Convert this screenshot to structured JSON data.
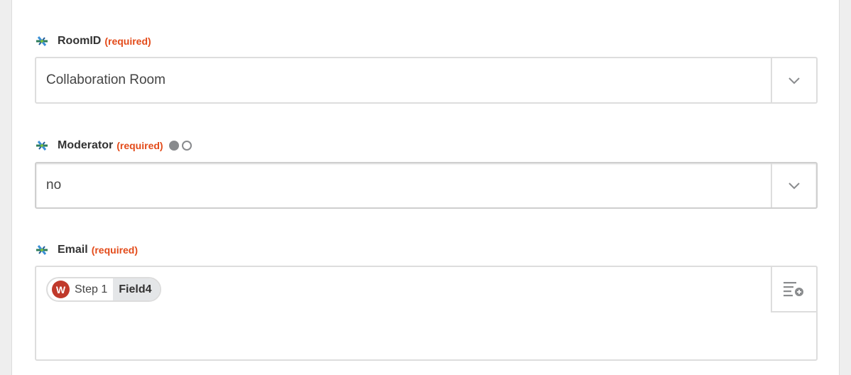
{
  "fields": [
    {
      "label": "RoomID",
      "required_text": "(required)",
      "value": "Collaboration Room",
      "control": "select"
    },
    {
      "label": "Moderator",
      "required_text": "(required)",
      "value": "no",
      "control": "select",
      "has_toggle": true
    },
    {
      "label": "Email",
      "required_text": "(required)",
      "control": "textarea",
      "token": {
        "app_logo_letter": "W",
        "step_label": "Step 1",
        "field_label": "Field4"
      }
    }
  ],
  "icons": {
    "app": "app-pinwheel-icon",
    "dropdown": "chevron-down-icon",
    "insert": "insert-field-icon"
  },
  "colors": {
    "required": "#e34b1a",
    "token_logo": "#c0392b",
    "token_field_bg": "#e4e6e8",
    "border": "#dddddd"
  }
}
